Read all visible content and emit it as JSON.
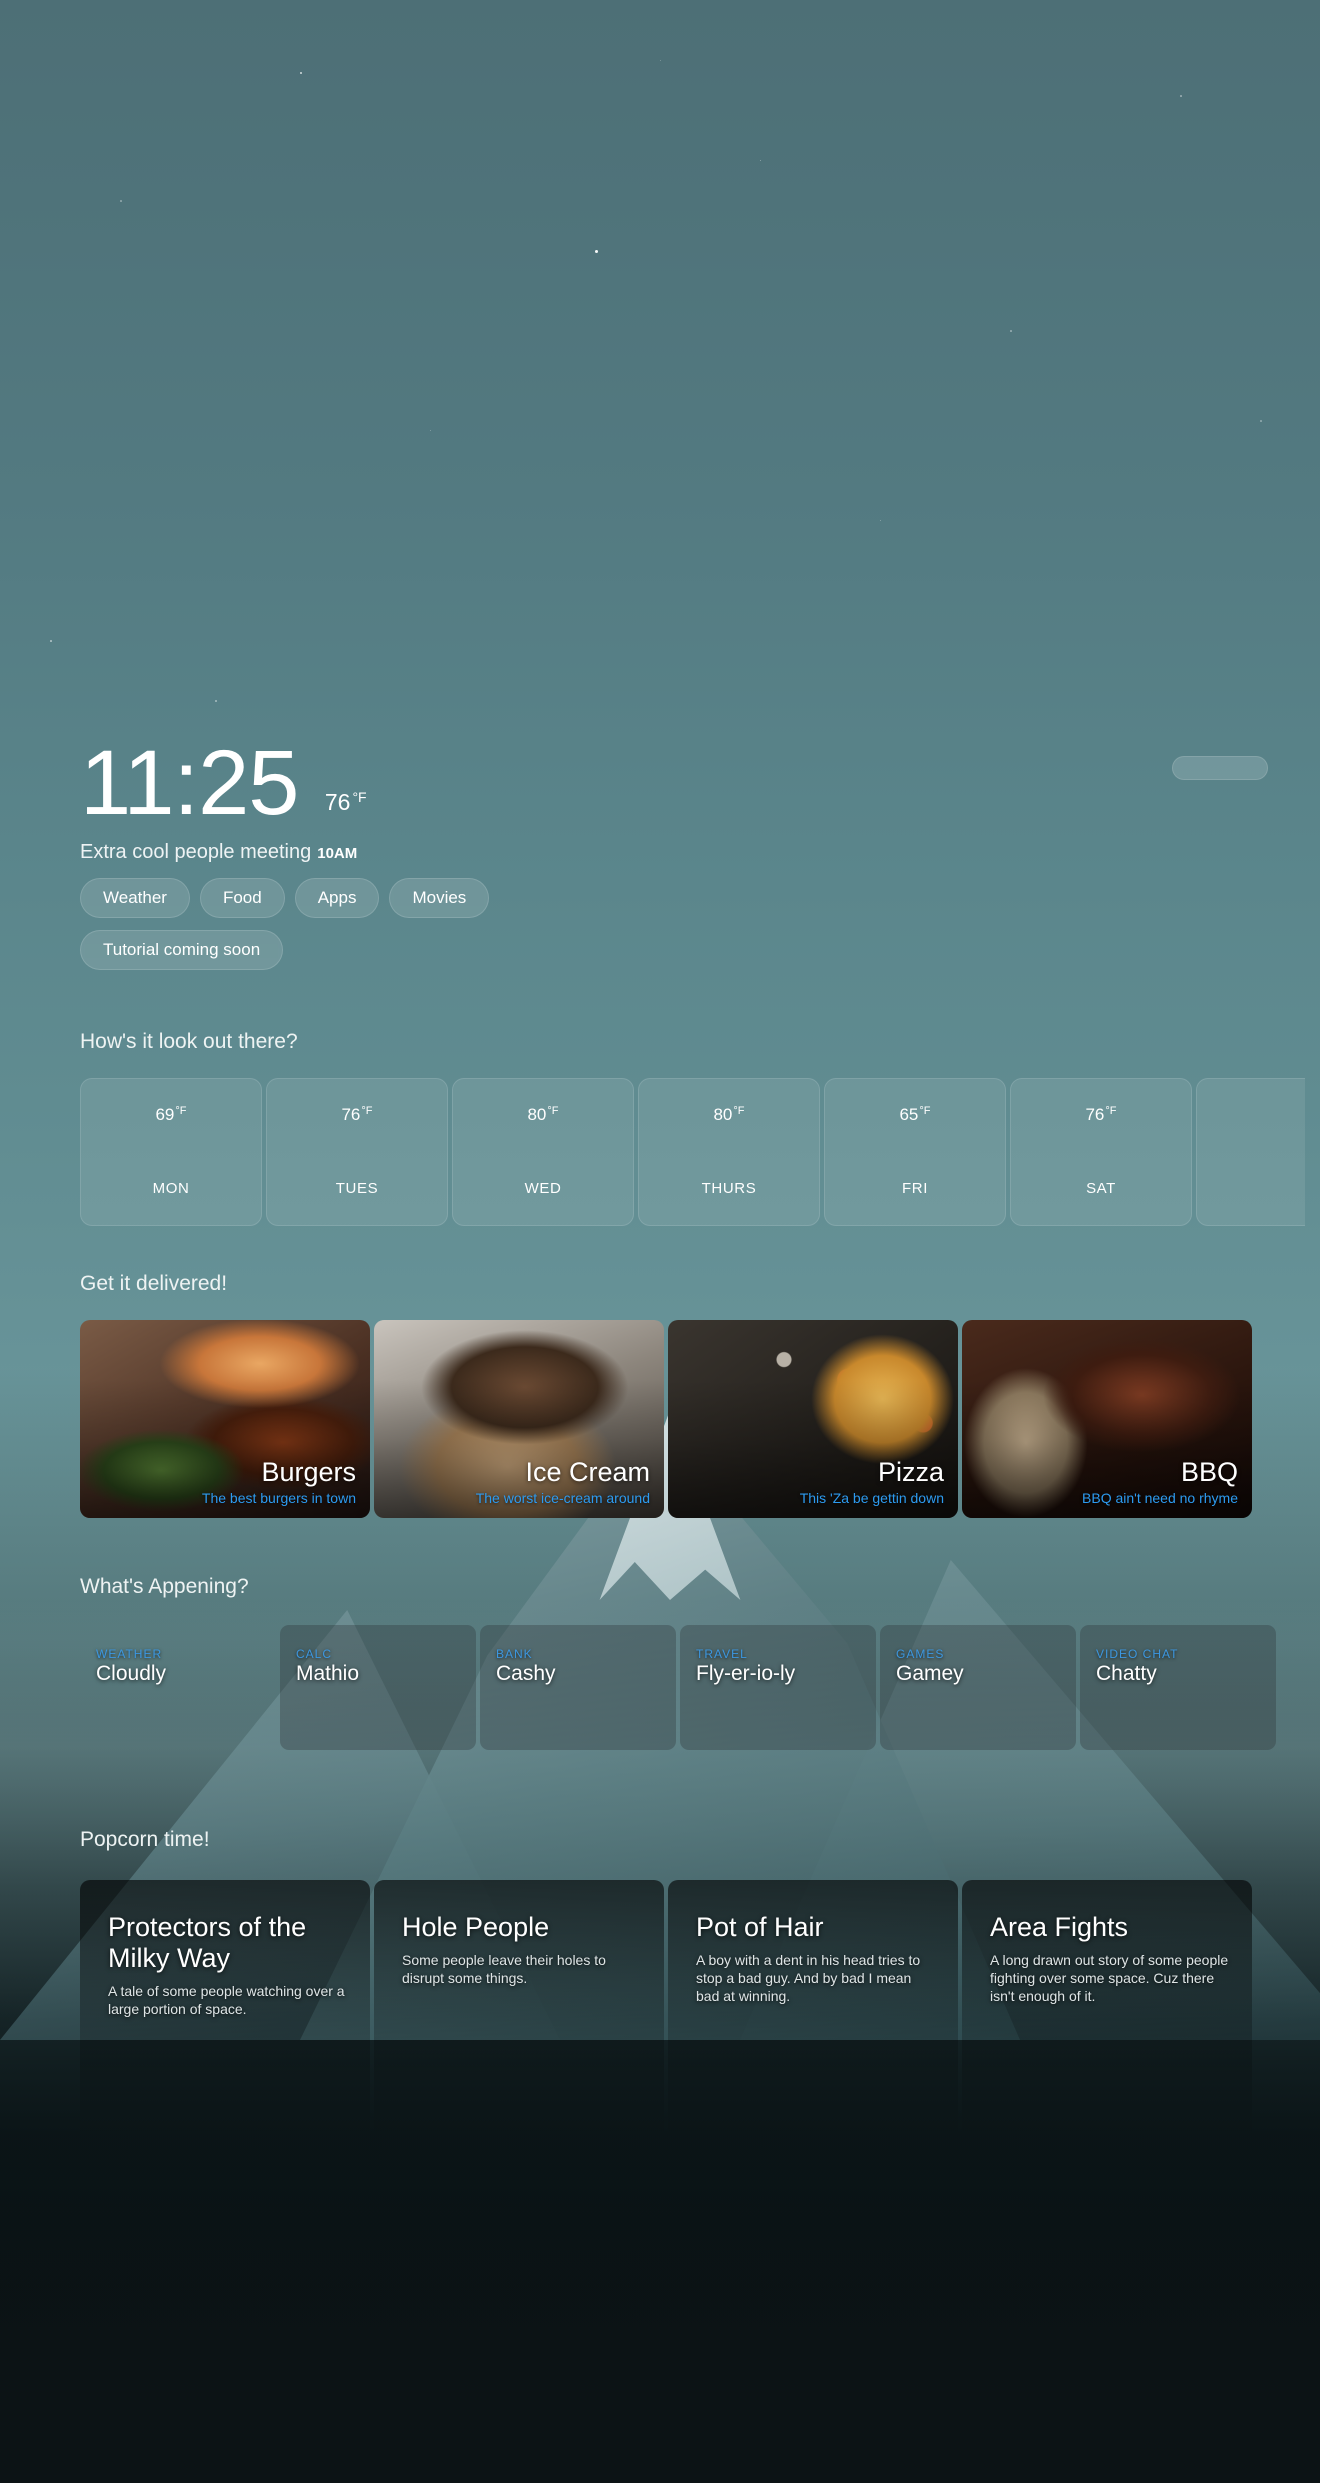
{
  "clock": {
    "time": "11:25",
    "temperature": "76",
    "temperature_unit": "°F",
    "event": "Extra cool people meeting",
    "event_time": "10AM"
  },
  "chips": [
    {
      "label": "Weather"
    },
    {
      "label": "Food"
    },
    {
      "label": "Apps"
    },
    {
      "label": "Movies"
    },
    {
      "label": "Tutorial coming soon"
    }
  ],
  "weather": {
    "title": "How's it look out there?",
    "days": [
      {
        "temp": "69",
        "unit": "°F",
        "day": "MON"
      },
      {
        "temp": "76",
        "unit": "°F",
        "day": "TUES"
      },
      {
        "temp": "80",
        "unit": "°F",
        "day": "WED"
      },
      {
        "temp": "80",
        "unit": "°F",
        "day": "THURS"
      },
      {
        "temp": "65",
        "unit": "°F",
        "day": "FRI"
      },
      {
        "temp": "76",
        "unit": "°F",
        "day": "SAT"
      }
    ]
  },
  "food": {
    "title": "Get it delivered!",
    "items": [
      {
        "title": "Burgers",
        "subtitle": "The best burgers in town"
      },
      {
        "title": "Ice Cream",
        "subtitle": "The worst ice-cream around"
      },
      {
        "title": "Pizza",
        "subtitle": "This 'Za be gettin down"
      },
      {
        "title": "BBQ",
        "subtitle": "BBQ ain't need no rhyme"
      }
    ]
  },
  "apps": {
    "title": "What's Appening?",
    "items": [
      {
        "category": "WEATHER",
        "name": "Cloudly"
      },
      {
        "category": "CALC",
        "name": "Mathio"
      },
      {
        "category": "BANK",
        "name": "Cashy"
      },
      {
        "category": "TRAVEL",
        "name": "Fly-er-io-ly"
      },
      {
        "category": "GAMES",
        "name": "Gamey"
      },
      {
        "category": "VIDEO CHAT",
        "name": "Chatty"
      }
    ]
  },
  "movies": {
    "title": "Popcorn time!",
    "items": [
      {
        "title": "Protectors of the Milky Way",
        "subtitle": "A tale of some people watching over a large portion of space."
      },
      {
        "title": "Hole People",
        "subtitle": "Some people leave their holes to disrupt some things."
      },
      {
        "title": "Pot of Hair",
        "subtitle": "A boy with a dent in his head tries to stop a bad guy. And by bad I mean bad at winning."
      },
      {
        "title": "Area Fights",
        "subtitle": "A long drawn out story of some people fighting over some space. Cuz there isn't enough of it."
      }
    ]
  },
  "colors": {
    "accent_link": "#2d9bf0",
    "app_category": "#3c97e0",
    "sky_top": "#4d6f76",
    "sky_mid": "#6d989c",
    "page_bottom": "#0c1315"
  }
}
